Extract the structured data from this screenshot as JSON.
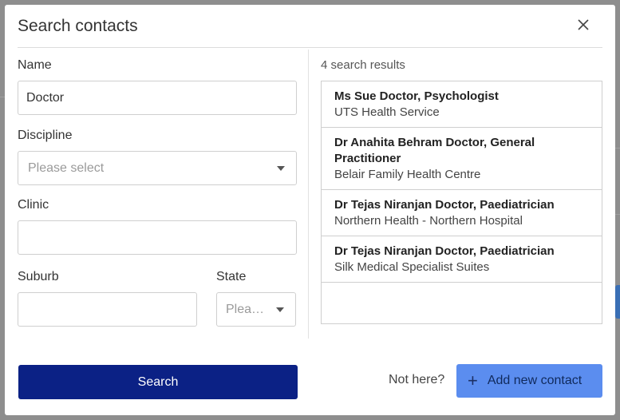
{
  "dialog": {
    "title": "Search contacts",
    "close_icon": "close-icon"
  },
  "form": {
    "name": {
      "label": "Name",
      "value": "Doctor"
    },
    "discipline": {
      "label": "Discipline",
      "placeholder": "Please select"
    },
    "clinic": {
      "label": "Clinic",
      "value": ""
    },
    "suburb": {
      "label": "Suburb",
      "value": ""
    },
    "state": {
      "label": "State",
      "placeholder": "Please select"
    }
  },
  "results": {
    "count_text": "4 search results",
    "items": [
      {
        "name": "Ms Sue Doctor, Psychologist",
        "clinic": "UTS Health Service"
      },
      {
        "name": "Dr Anahita Behram Doctor, General Practitioner",
        "clinic": "Belair Family Health Centre"
      },
      {
        "name": "Dr Tejas Niranjan Doctor, Paediatrician",
        "clinic": "Northern Health - Northern Hospital"
      },
      {
        "name": "Dr Tejas Niranjan Doctor, Paediatrician",
        "clinic": "Silk Medical Specialist Suites"
      }
    ]
  },
  "footer": {
    "search_label": "Search",
    "not_here_text": "Not here?",
    "add_label": "Add new contact",
    "add_icon": "plus-icon"
  },
  "colors": {
    "primary": "#0b2185",
    "secondary": "#5b8def",
    "overlay": "#8e8e8e"
  }
}
